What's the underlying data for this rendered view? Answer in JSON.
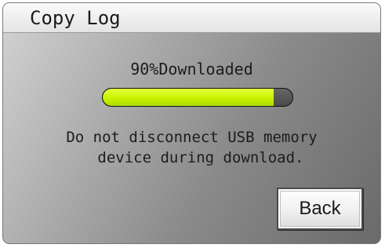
{
  "dialog": {
    "title": "Copy Log"
  },
  "progress": {
    "label": "90%Downloaded",
    "percent": 90,
    "fill_color": "#c8f200"
  },
  "message": {
    "line1": "Do not disconnect USB memory",
    "line2": "  device during download."
  },
  "buttons": {
    "back_label": "Back"
  }
}
